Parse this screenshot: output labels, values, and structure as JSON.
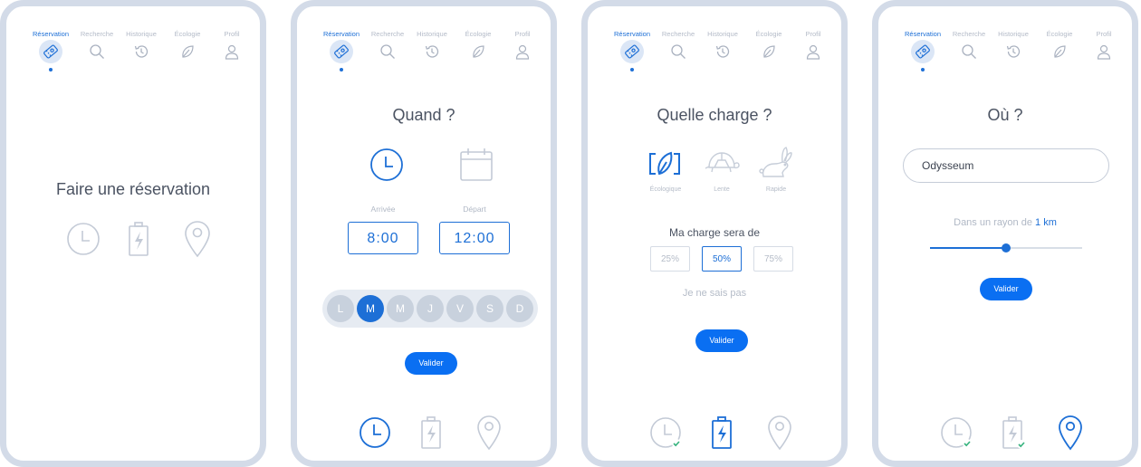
{
  "nav": {
    "items": [
      {
        "label": "Réservation",
        "icon": "ticket-icon"
      },
      {
        "label": "Recherche",
        "icon": "search-icon"
      },
      {
        "label": "Historique",
        "icon": "history-icon"
      },
      {
        "label": "Écologie",
        "icon": "leaf-icon"
      },
      {
        "label": "Profil",
        "icon": "user-icon"
      }
    ]
  },
  "screen1": {
    "title": "Faire une réservation"
  },
  "screen2": {
    "title": "Quand ?",
    "arrival_label": "Arrivée",
    "departure_label": "Départ",
    "arrival_time": "8:00",
    "departure_time": "12:00",
    "days": [
      "L",
      "M",
      "M",
      "J",
      "V",
      "S",
      "D"
    ],
    "selected_day_index": 1,
    "validate": "Valider"
  },
  "screen3": {
    "title": "Quelle charge ?",
    "modes": [
      "Écologique",
      "Lente",
      "Rapide"
    ],
    "charge_prompt": "Ma charge sera de",
    "percents": [
      "25%",
      "50%",
      "75%"
    ],
    "selected_percent": "50%",
    "unknown": "Je ne sais pas",
    "validate": "Valider"
  },
  "screen4": {
    "title": "Où ?",
    "location_value": "Odysseum",
    "radius_prefix": "Dans un rayon de",
    "radius_value": "1 km",
    "slider_level": 0.5,
    "validate": "Valider"
  },
  "colors": {
    "accent": "#1d6fd6",
    "button": "#0a6ff2",
    "frame": "#d3dbe8",
    "muted": "#b4bbc8",
    "check": "#36b37e"
  }
}
